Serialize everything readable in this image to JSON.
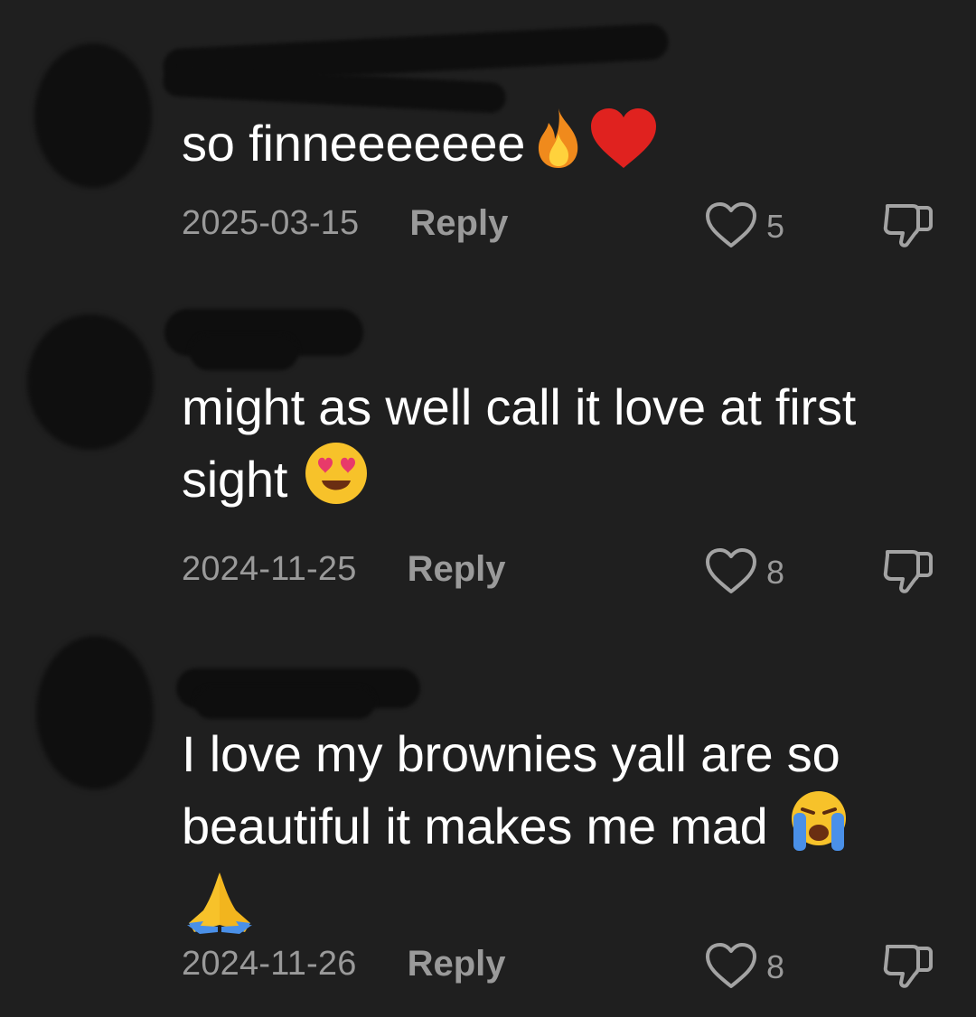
{
  "comments": [
    {
      "text": "so finneeeeeee",
      "emojis": [
        "fire-emoji",
        "red-heart-emoji"
      ],
      "date": "2025-03-15",
      "reply_label": "Reply",
      "likes": "5"
    },
    {
      "text": "might as well call it love at first sight",
      "emojis": [
        "heart-eyes-emoji"
      ],
      "date": "2024-11-25",
      "reply_label": "Reply",
      "likes": "8"
    },
    {
      "text": "I love my brownies yall are so beautiful it makes me mad",
      "emojis": [
        "loudly-crying-emoji",
        "folded-hands-emoji"
      ],
      "date": "2024-11-26",
      "reply_label": "Reply",
      "likes": "8"
    }
  ],
  "icons": {
    "like": "heart-outline-icon",
    "dislike": "thumbs-down-icon"
  },
  "colors": {
    "background": "#1f1f1f",
    "text": "#ffffff",
    "secondary_text": "#9a9a9a"
  }
}
